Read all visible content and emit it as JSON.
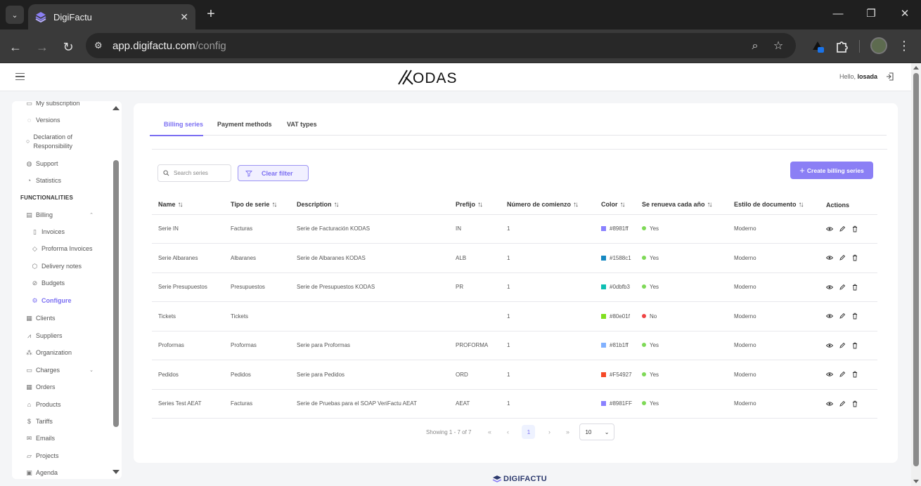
{
  "browser": {
    "tab_title": "DigiFactu",
    "url_host": "app.digifactu.com",
    "url_path": "/config"
  },
  "header": {
    "logo_text": "KODAS",
    "hello_label": "Hello,",
    "user": "losada"
  },
  "sidebar": {
    "items_top": [
      {
        "label": "My subscription",
        "icon": "subscription-icon"
      },
      {
        "label": "Versions",
        "icon": "versions-icon"
      },
      {
        "label": "Declaration of Responsibility",
        "icon": "declaration-icon"
      },
      {
        "label": "Support",
        "icon": "support-icon"
      },
      {
        "label": "Statistics",
        "icon": "statistics-icon"
      }
    ],
    "section": "FUNCTIONALITIES",
    "billing": "Billing",
    "billing_children": [
      {
        "label": "Invoices",
        "icon": "invoice-icon"
      },
      {
        "label": "Proforma Invoices",
        "icon": "tag-icon"
      },
      {
        "label": "Delivery notes",
        "icon": "box-icon"
      },
      {
        "label": "Budgets",
        "icon": "paperclip-icon"
      },
      {
        "label": "Configure",
        "icon": "gear-icon",
        "active": true
      }
    ],
    "items_bottom": [
      {
        "label": "Clients",
        "icon": "clients-icon"
      },
      {
        "label": "Suppliers",
        "icon": "suppliers-icon"
      },
      {
        "label": "Organization",
        "icon": "organization-icon"
      },
      {
        "label": "Charges",
        "icon": "charges-icon"
      },
      {
        "label": "Orders",
        "icon": "orders-icon"
      },
      {
        "label": "Products",
        "icon": "products-icon"
      },
      {
        "label": "Tariffs",
        "icon": "dollar-icon"
      },
      {
        "label": "Emails",
        "icon": "mail-icon"
      },
      {
        "label": "Projects",
        "icon": "folder-icon"
      },
      {
        "label": "Agenda",
        "icon": "calendar-icon"
      }
    ]
  },
  "tabs": [
    "Billing series",
    "Payment methods",
    "VAT types"
  ],
  "toolbar": {
    "search_placeholder": "Search series",
    "clear_filter": "Clear filter",
    "create": "Create billing series"
  },
  "table": {
    "columns": [
      "Name",
      "Tipo de serie",
      "Description",
      "Prefijo",
      "Número de comienzo",
      "Color",
      "Se renueva cada año",
      "Estilo de documento",
      "Actions"
    ],
    "rows": [
      {
        "name": "Serie IN",
        "tipo": "Facturas",
        "description": "Serie de Facturación KODAS",
        "prefijo": "IN",
        "numero": "1",
        "color": "#8981ff",
        "color_hex": "#8981ff",
        "renueva": "Yes",
        "estilo": "Moderno"
      },
      {
        "name": "Serie Albaranes",
        "tipo": "Albaranes",
        "description": "Serie de Albaranes KODAS",
        "prefijo": "ALB",
        "numero": "1",
        "color": "#1588c1",
        "color_hex": "#1588c1",
        "renueva": "Yes",
        "estilo": "Moderno"
      },
      {
        "name": "Serie Presupuestos",
        "tipo": "Presupuestos",
        "description": "Serie de Presupuestos KODAS",
        "prefijo": "PR",
        "numero": "1",
        "color": "#0dbfb3",
        "color_hex": "#0dbfb3",
        "renueva": "Yes",
        "estilo": "Moderno"
      },
      {
        "name": "Tickets",
        "tipo": "Tickets",
        "description": "",
        "prefijo": "",
        "numero": "1",
        "color": "#80e01f",
        "color_hex": "#80e01f",
        "renueva": "No",
        "estilo": "Moderno"
      },
      {
        "name": "Proformas",
        "tipo": "Proformas",
        "description": "Serie para Proformas",
        "prefijo": "PROFORMA",
        "numero": "1",
        "color": "#81b1ff",
        "color_hex": "#81b1ff",
        "renueva": "Yes",
        "estilo": "Moderno"
      },
      {
        "name": "Pedidos",
        "tipo": "Pedidos",
        "description": "Serie para Pedidos",
        "prefijo": "ORD",
        "numero": "1",
        "color": "#F54927",
        "color_hex": "#F54927",
        "renueva": "Yes",
        "estilo": "Moderno"
      },
      {
        "name": "Series Test AEAT",
        "tipo": "Facturas",
        "description": "Serie de Pruebas para el SOAP VeriFactu AEAT",
        "prefijo": "AEAT",
        "numero": "1",
        "color": "#8981FF",
        "color_hex": "#8981FF",
        "renueva": "Yes",
        "estilo": "Moderno"
      }
    ]
  },
  "pagination": {
    "showing": "Showing 1 - 7 of 7",
    "current_page": "1",
    "page_size": "10"
  },
  "footer": {
    "brand": "DIGIFACTU"
  },
  "colors": {
    "accent": "#7b6ff2",
    "yes": "#7ed957",
    "no": "#ef4444"
  }
}
